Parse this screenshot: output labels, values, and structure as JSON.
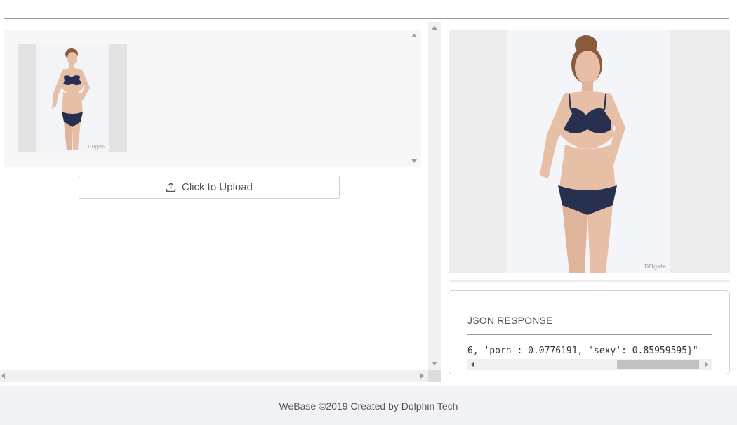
{
  "upload": {
    "button_label": "Click to Upload",
    "icon": "upload-icon"
  },
  "thumbnail": {
    "subject": "woman in navy lingerie, full body, standing",
    "watermark": "DHgate"
  },
  "preview": {
    "subject": "woman in navy lingerie, full body, standing",
    "watermark": "DHgate"
  },
  "json_panel": {
    "title": "JSON RESPONSE",
    "text": "6, 'porn': 0.0776191, 'sexy': 0.85959595}\""
  },
  "footer": {
    "text": "WeBase ©2019 Created by Dolphin Tech"
  },
  "colors": {
    "panel_bg": "#f7f7f7",
    "footer_bg": "#f0f2f5",
    "lingerie": "#27314f",
    "skin": "#e7bfa6",
    "hair": "#8a5a3c"
  }
}
